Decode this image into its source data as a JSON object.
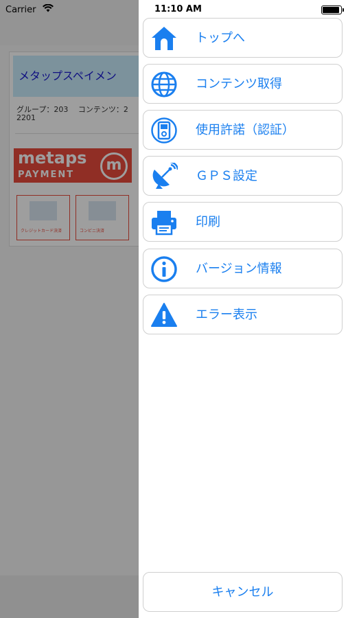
{
  "background_app": {
    "carrier": "Carrier",
    "title": "メタップスペイメン",
    "group_line1": "グループ：203　 コンテンツ：2",
    "group_line2": "2201",
    "logo_top": "metaps",
    "logo_bottom": "PAYMENT",
    "logo_badge": "m",
    "tiles": [
      {
        "caption": "クレジットカード決済"
      },
      {
        "caption": "コンビニ決済"
      }
    ]
  },
  "menu": {
    "time": "11:10 AM",
    "items": [
      {
        "label": "トップへ",
        "icon": "home-icon"
      },
      {
        "label": "コンテンツ取得",
        "icon": "globe-icon"
      },
      {
        "label": "使用許諾（認証）",
        "icon": "device-icon"
      },
      {
        "label": "ＧＰＳ設定",
        "icon": "satellite-dish-icon"
      },
      {
        "label": "印刷",
        "icon": "printer-icon"
      },
      {
        "label": "バージョン情報",
        "icon": "info-icon"
      },
      {
        "label": "エラー表示",
        "icon": "warning-icon"
      }
    ],
    "cancel_label": "キャンセル"
  },
  "colors": {
    "accent": "#1a7fef",
    "dim_overlay": "rgba(0,0,0,0.38)",
    "logo_red": "#e94b3c",
    "title_bar": "#c8ecfc"
  }
}
